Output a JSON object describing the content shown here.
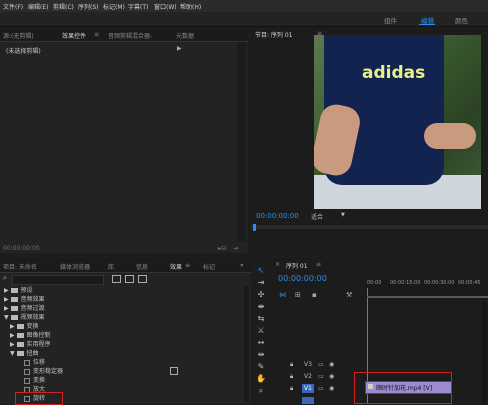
{
  "menu": [
    "文件(F)",
    "编辑(E)",
    "剪辑(C)",
    "序列(S)",
    "标记(M)",
    "字幕(T)",
    "窗口(W)",
    "帮助(H)"
  ],
  "workspaces": {
    "items": [
      "组件",
      "编辑",
      "颜色"
    ],
    "active": "编辑"
  },
  "effect_controls": {
    "tabs": [
      "源:(无剪辑)",
      "效果控件",
      "音频剪辑混合器:",
      "元数据"
    ],
    "active_tab": "效果控件",
    "no_clip": "(未选择剪辑)",
    "time": "00:00:00:00"
  },
  "program_monitor": {
    "title": "节目: 序列 01",
    "timecode": "00:00:00:00",
    "fit": "适合",
    "shirt_text": "adidas"
  },
  "project_panel": {
    "tabs": [
      "项目: 未命名",
      "媒体浏览器",
      "库",
      "信息",
      "效果",
      "标记"
    ],
    "active_tab": "效果",
    "tree": [
      {
        "label": "预设",
        "level": 0,
        "type": "folder"
      },
      {
        "label": "音频效果",
        "level": 0,
        "type": "folder"
      },
      {
        "label": "音频过渡",
        "level": 0,
        "type": "folder"
      },
      {
        "label": "视频效果",
        "level": 0,
        "type": "folder",
        "open": true
      },
      {
        "label": "变换",
        "level": 1,
        "type": "folder"
      },
      {
        "label": "图像控制",
        "level": 1,
        "type": "folder"
      },
      {
        "label": "实用程序",
        "level": 1,
        "type": "folder"
      },
      {
        "label": "扭曲",
        "level": 1,
        "type": "folder",
        "open": true
      },
      {
        "label": "位移",
        "level": 2,
        "type": "fx"
      },
      {
        "label": "变形稳定器",
        "level": 2,
        "type": "fx"
      },
      {
        "label": "变换",
        "level": 2,
        "type": "fx"
      },
      {
        "label": "放大",
        "level": 2,
        "type": "fx"
      },
      {
        "label": "旋转",
        "level": 2,
        "type": "fx"
      }
    ]
  },
  "timeline": {
    "title": "序列 01",
    "timecode": "00:00:00:00",
    "ruler": [
      "00:00",
      "00:00:15:00",
      "00:00:30:00",
      "00:00:45"
    ],
    "tracks": [
      "V3",
      "V2",
      "V1"
    ],
    "clip_label": "顺时针加花.mp4 [V]"
  },
  "colors": {
    "accent": "#2d8ceb",
    "selected_track": "#3a67b8",
    "highlight": "#d02020"
  }
}
